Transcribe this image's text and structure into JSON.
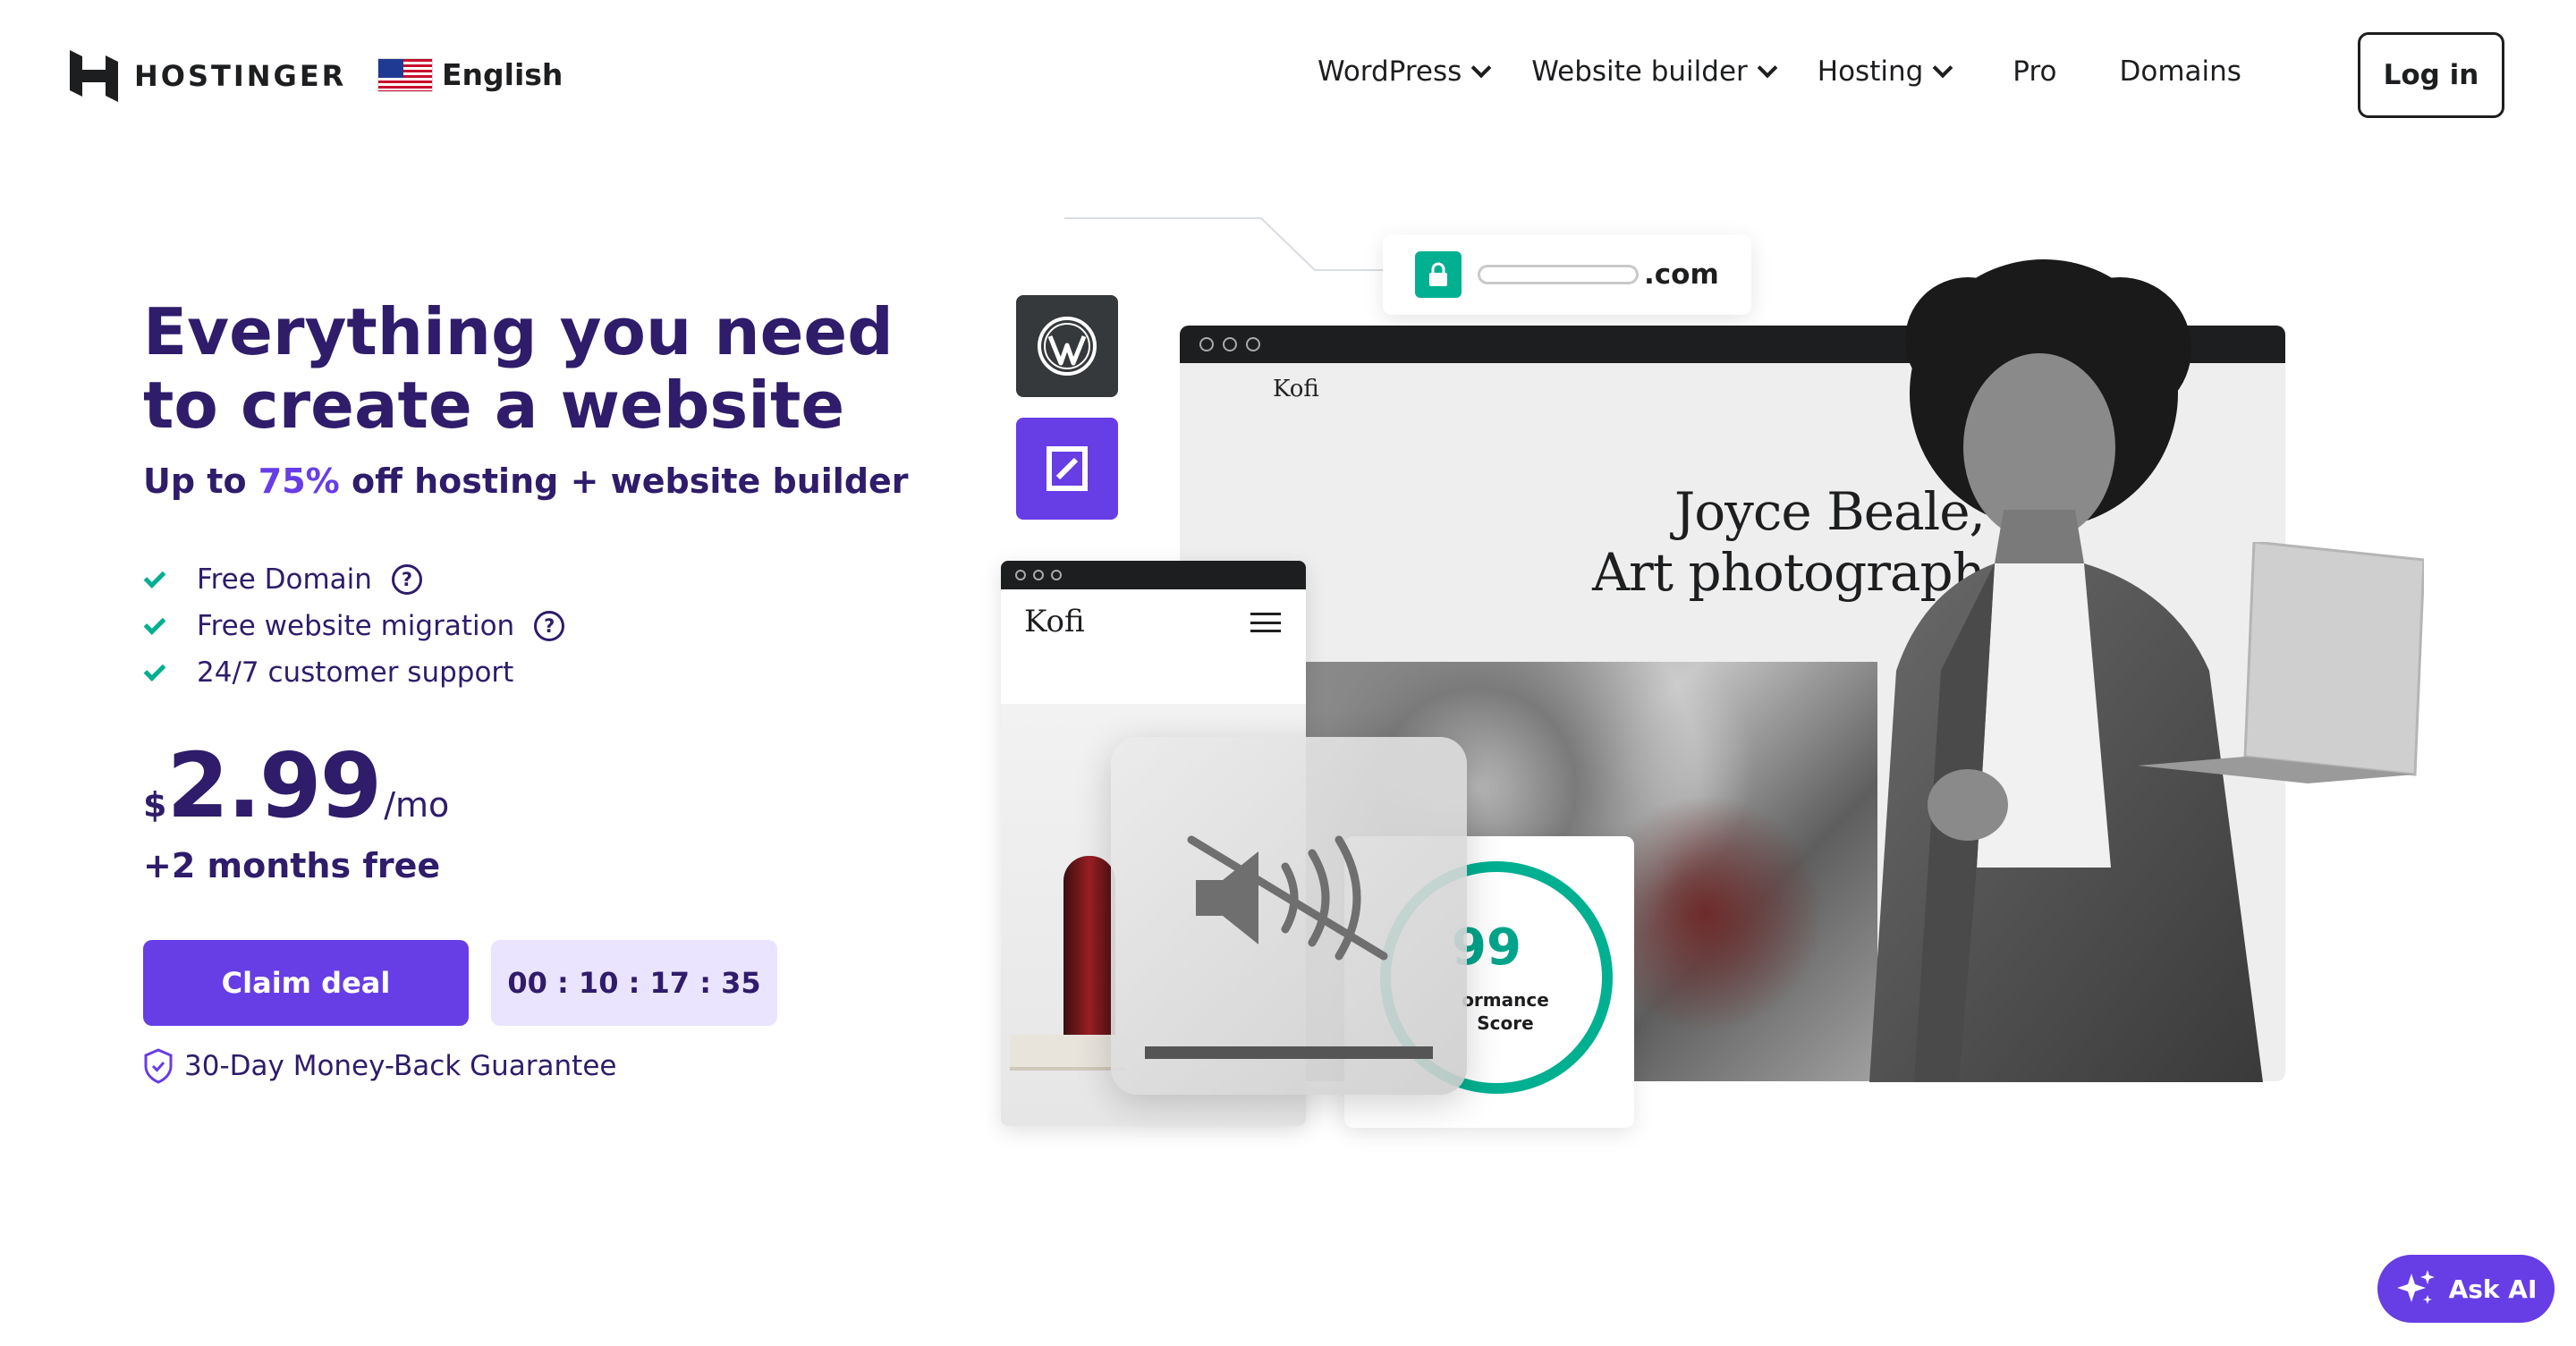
{
  "header": {
    "brand": "HOSTINGER",
    "language": "English",
    "nav": [
      {
        "label": "WordPress",
        "dropdown": true
      },
      {
        "label": "Website builder",
        "dropdown": true
      },
      {
        "label": "Hosting",
        "dropdown": true
      },
      {
        "label": "Pro",
        "dropdown": false
      },
      {
        "label": "Domains",
        "dropdown": false
      }
    ],
    "login_label": "Log in"
  },
  "hero": {
    "title": "Everything you need to create a website",
    "subtitle_before": "Up to ",
    "subtitle_highlight": "75%",
    "subtitle_after": " off hosting + website builder",
    "features": [
      {
        "label": "Free Domain",
        "help": true
      },
      {
        "label": "Free website migration",
        "help": true
      },
      {
        "label": "24/7 customer support",
        "help": false
      }
    ],
    "price": {
      "currency": "$",
      "amount": "2.99",
      "period": "/mo"
    },
    "bonus": "+2 months free",
    "cta_label": "Claim deal",
    "timer": "00 : 10 : 17 : 35",
    "guarantee": "30-Day Money-Back Guarantee"
  },
  "illustration": {
    "url_suffix": ".com",
    "site_name": "Kofi",
    "headline_line1": "Joyce Beale,",
    "headline_line2": "Art photograph",
    "score_value": "99",
    "score_label_line1": "ormance",
    "score_label_line2": "Score"
  },
  "ask_ai_label": "Ask AI",
  "colors": {
    "brand_purple": "#673de6",
    "text_navy": "#2f1c6a",
    "green": "#00b090",
    "timer_bg": "#ebe4ff"
  },
  "icons": [
    "hostinger-logo-icon",
    "us-flag-icon",
    "chevron-down-icon",
    "check-icon",
    "help-circle-icon",
    "shield-check-icon",
    "lock-icon",
    "wordpress-icon",
    "hostinger-builder-icon",
    "hamburger-menu-icon",
    "mute-icon",
    "sparkle-icon"
  ]
}
